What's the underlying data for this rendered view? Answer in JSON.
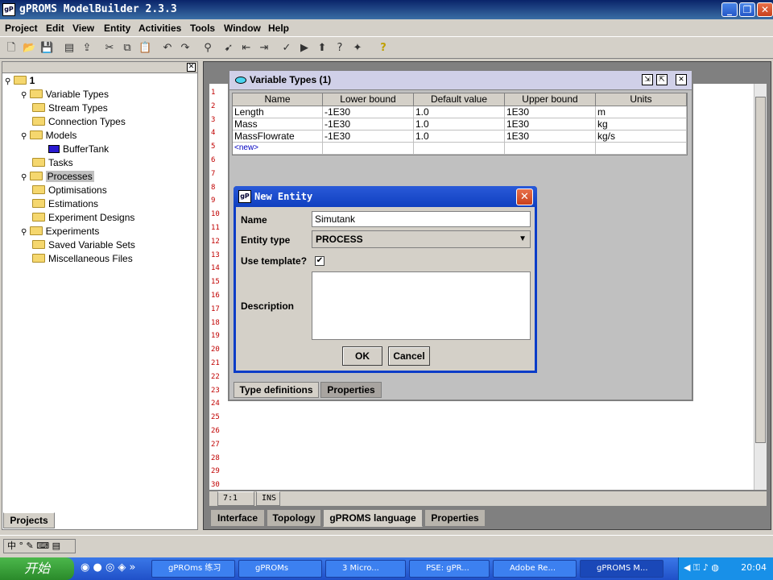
{
  "window": {
    "title": "gPROMS ModelBuilder 2.3.3"
  },
  "menu": [
    "Project",
    "Edit",
    "View",
    "Entity",
    "Activities",
    "Tools",
    "Window",
    "Help"
  ],
  "tree": {
    "root": "1",
    "items": [
      {
        "label": "Variable Types",
        "expanded": true
      },
      {
        "label": "Stream Types"
      },
      {
        "label": "Connection Types"
      },
      {
        "label": "Models",
        "expanded": true
      },
      {
        "label": "BufferTank",
        "child": true
      },
      {
        "label": "Tasks"
      },
      {
        "label": "Processes",
        "expanded": true,
        "selected": true
      },
      {
        "label": "Optimisations"
      },
      {
        "label": "Estimations"
      },
      {
        "label": "Experiment Designs"
      },
      {
        "label": "Experiments",
        "expanded": true
      },
      {
        "label": "Saved Variable Sets"
      },
      {
        "label": "Miscellaneous Files"
      }
    ]
  },
  "left_tab": "Projects",
  "editor": {
    "line_numbers": [
      "1",
      "2",
      "3",
      "4",
      "5",
      "6",
      "7",
      "8",
      "9",
      "10",
      "11",
      "12",
      "13",
      "14",
      "15",
      "16",
      "17",
      "18",
      "19",
      "20",
      "21",
      "22",
      "23",
      "24",
      "25",
      "26",
      "27",
      "28",
      "29",
      "30"
    ],
    "cursor": "7:1",
    "mode": "INS",
    "tabs": [
      "Interface",
      "Topology",
      "gPROMS language",
      "Properties"
    ],
    "active_tab": "gPROMS language"
  },
  "variable_types": {
    "title": "Variable Types (1)",
    "columns": [
      "Name",
      "Lower bound",
      "Default value",
      "Upper bound",
      "Units"
    ],
    "rows": [
      [
        "Length",
        "-1E30",
        "1.0",
        "1E30",
        "m"
      ],
      [
        "Mass",
        "-1E30",
        "1.0",
        "1E30",
        "kg"
      ],
      [
        "MassFlowrate",
        "-1E30",
        "1.0",
        "1E30",
        "kg/s"
      ]
    ],
    "new_row": "<new>",
    "tabs": [
      "Type definitions",
      "Properties"
    ]
  },
  "dialog": {
    "title": "New Entity",
    "name_label": "Name",
    "name_value": "Simutank",
    "type_label": "Entity type",
    "type_value": "PROCESS",
    "template_label": "Use template?",
    "template_checked": true,
    "description_label": "Description",
    "ok_label": "OK",
    "cancel_label": "Cancel"
  },
  "taskbar": {
    "start": "开始",
    "tasks": [
      "gPROms 练习",
      "gPROMs",
      "3 Micro...",
      "PSE: gPR...",
      "Adobe Re...",
      "gPROMS M..."
    ],
    "clock": "20:04"
  }
}
